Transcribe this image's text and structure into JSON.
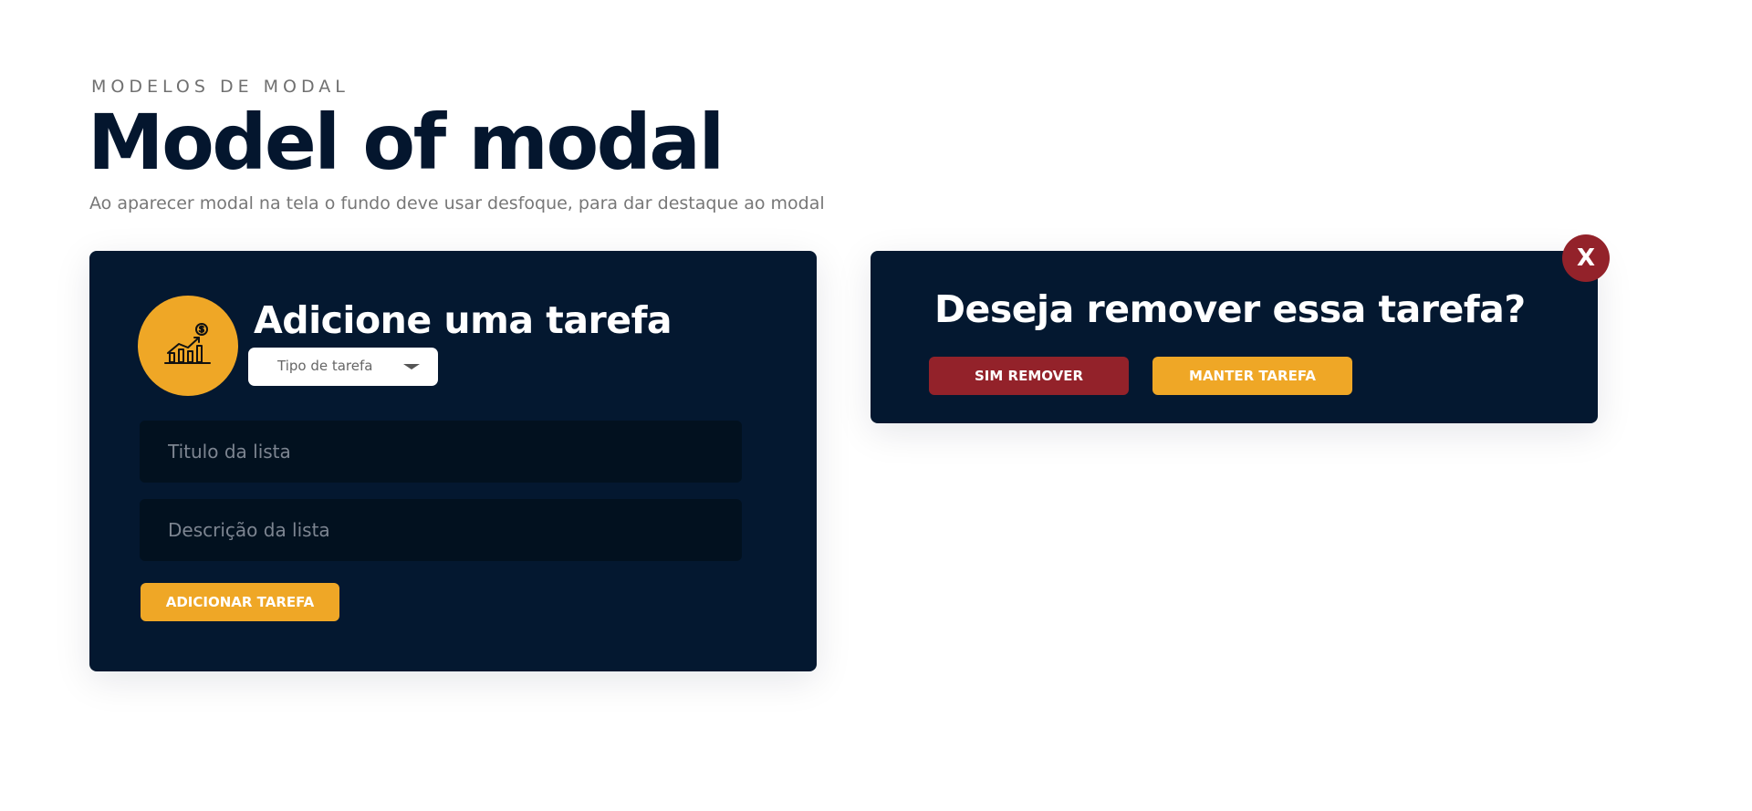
{
  "header": {
    "eyebrow": "MODELOS DE MODAL",
    "title": "Model of modal",
    "subtitle": "Ao aparecer modal na tela o fundo deve usar desfoque, para dar destaque ao modal"
  },
  "add_task_modal": {
    "icon": "chart-growth-dollar-icon",
    "title": "Adicione uma tarefa",
    "select": {
      "selected_value": "Tipo de tarefa",
      "caret_icon": "chevron-down-icon"
    },
    "title_field": {
      "value": "",
      "placeholder": "Titulo da lista"
    },
    "description_field": {
      "value": "",
      "placeholder": "Descrição da lista"
    },
    "submit_label": "ADICIONAR TAREFA"
  },
  "remove_task_modal": {
    "title": "Deseja remover essa tarefa?",
    "confirm_label": "SIM REMOVER",
    "keep_label": "MANTER TAREFA",
    "close_label": "X"
  },
  "colors": {
    "navy": "#041830",
    "field_bg": "#02111f",
    "accent_yellow": "#efa726",
    "danger_red": "#93222a",
    "heading": "#04162e"
  }
}
